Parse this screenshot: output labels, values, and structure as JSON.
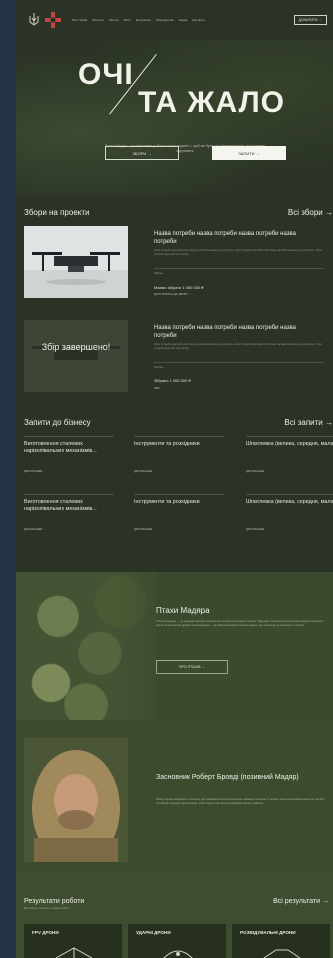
{
  "header": {
    "nav": [
      "Про Птахів",
      "Проекти",
      "Запити",
      "Звіти",
      "Результати",
      "Партнерство",
      "Медіа",
      "Контакти"
    ],
    "cta": "ДОНАТИТИ →"
  },
  "hero": {
    "line1": "ОЧІ",
    "line2": "ТА ЖАЛО",
    "subtitle": "Птахи Мадяра - це ефективна робота кожної людини. І, щоб ми були ще ефективнішими, пропонуємо підтримати",
    "btn_projects": "ЗБОРИ →",
    "btn_requests": "ЗАПИТИ →"
  },
  "projects": {
    "heading": "Збори на проекти",
    "all_link": "Всі збори →",
    "items": [
      {
        "title": "Назва потреби назва потреби назва потреби назва потреби",
        "desc": "Опис потреби короткий опис збору на який ви можете долучитись. Опис потреби короткий опис збору на який ви можете долучитись. Опис потреби короткий опис збору.",
        "note": "Зібрано",
        "sum": "Маємо зібрати 1 000 000 ₴",
        "link": "ДОЛУЧИТИСЬ ДО ЗБОРУ →",
        "image_overlay": ""
      },
      {
        "title": "Назва потреби назва потреби назва потреби назва потреби",
        "desc": "Опис потреби короткий опис збору на який ви можете долучитись. Опис потреби короткий опис збору на який ви можете долучитись. Опис потреби короткий опис збору.",
        "note": "Зібрано",
        "sum": "Зібрано 1 000 000 ₴",
        "link": "ЗВІТ →",
        "image_overlay": "Збір завершено!"
      }
    ]
  },
  "requests": {
    "heading": "Запити до бізнесу",
    "all_link": "Всі запити →",
    "items": [
      {
        "title": "Виготовлення сталевих нарізопівальних механізмів...",
        "link": "ДЕТАЛЬНІШЕ"
      },
      {
        "title": "Інструменти та розхідники",
        "link": "ДЕТАЛЬНІШЕ"
      },
      {
        "title": "Шпатлевка (велика, середня, мала)",
        "link": "ДЕТАЛЬНІШЕ"
      },
      {
        "title": "Виготовлення сталевих нарізопівальних механізмів...",
        "link": "ДЕТАЛЬНІШЕ"
      },
      {
        "title": "Інструменти та розхідники",
        "link": "ДЕТАЛЬНІШЕ"
      },
      {
        "title": "Шпатлевка (велика, середня, мала)",
        "link": "ДЕТАЛЬНІШЕ"
      }
    ]
  },
  "birds": {
    "title": "Птахи Мадяра",
    "text": "«Птахи Мадяра» — це ударний підрозділ безпілотних систем Сил оборони України. Підрозділ спеціалізується на аеророзвідці та ураженні ворога за допомогою дронів. Наша команда — це ефективна робота кожної людини, від оператора до інженера та логіста.",
    "button": "ПРО ПТАХІВ →"
  },
  "founder": {
    "title": "Засновник Роберт Бровді (позивний Мадяр)",
    "text": "Роберт Бровді народився в Ужгороді. До повномасштабного вторгнення займався бізнесом. З перших днів пішов добровольцем до лав ЗСУ та створив підрозділ аеророзвідки, який згодом став одним із найефективніших у війську."
  },
  "results": {
    "heading": "Результати роботи",
    "sub": "Моніторинг станом на червень 2024 р.",
    "all_link": "Всі результати →",
    "cards": [
      "FPV ДРОНИ",
      "УДАРНІ ДРОНИ",
      "РОЗВІДУВАЛЬНІ ДРОНИ"
    ]
  },
  "colors": {
    "accent_red": "#c6463f",
    "bg_olive": "#2a3325",
    "outer_blue": "#243346"
  }
}
